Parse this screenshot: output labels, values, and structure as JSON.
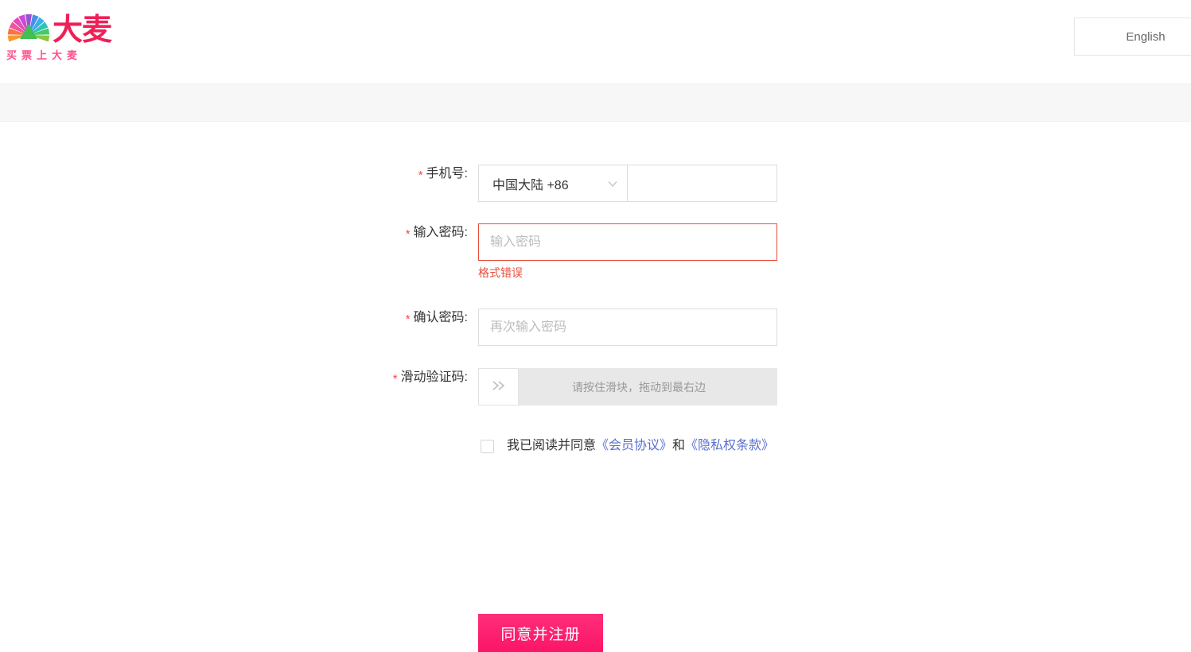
{
  "header": {
    "logo": {
      "brand": "大麦",
      "tagline": "买票上大麦",
      "icon": "damai-fan-logo"
    },
    "language_button": "English"
  },
  "form": {
    "phone": {
      "label": "手机号:",
      "required_mark": "*",
      "country_value": "中国大陆 +86",
      "number_value": "",
      "number_placeholder": ""
    },
    "password": {
      "label": "输入密码:",
      "required_mark": "*",
      "value": "",
      "placeholder": "输入密码",
      "error": "格式错误"
    },
    "confirm_password": {
      "label": "确认密码:",
      "required_mark": "*",
      "value": "",
      "placeholder": "再次输入密码"
    },
    "captcha": {
      "label": "滑动验证码:",
      "required_mark": "*",
      "handle_glyph": "»",
      "track_text": "请按住滑块，拖动到最右边"
    },
    "agreement": {
      "checked": false,
      "prefix": "我已阅读并同意",
      "link1": "《会员协议》",
      "conjunction": "和",
      "link2": "《隐私权条款》"
    },
    "submit_label": "同意并注册"
  },
  "colors": {
    "brand_pink": "#f01f58",
    "button_pink": "#ff2573",
    "error_red": "#e84d3d",
    "link_blue": "#5a6fd0",
    "band_gray": "#f7f7f7"
  }
}
